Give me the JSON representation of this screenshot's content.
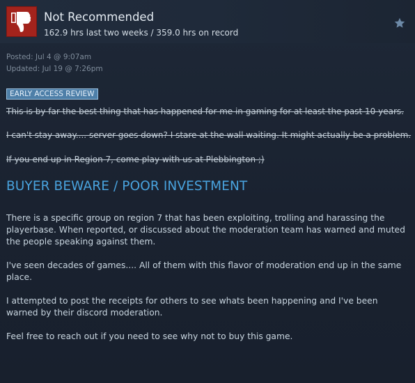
{
  "review": {
    "recommendation": "Not Recommended",
    "hours": "162.9 hrs last two weeks / 359.0 hrs on record",
    "posted": "Posted: Jul 4 @ 9:07am",
    "updated": "Updated: Jul 19 @ 7:26pm",
    "badge": "EARLY ACCESS REVIEW",
    "struck_lines": [
      "This is by far the best thing that has happened for me in gaming for at least the past 10 years.",
      "I can't stay away.... server goes down? I stare at the wall waiting. It might actually be a problem.",
      "If you end up in Region 7, come play with us at Plebbington ;)"
    ],
    "headline": "BUYER BEWARE / POOR INVESTMENT",
    "paragraphs": [
      "There is a specific group on region 7 that has been exploiting, trolling and harassing the playerbase. When reported, or discussed about the moderation team has warned and muted the people speaking against them.",
      "I've seen decades of games.... All of them with this flavor of moderation end up in the same place.",
      "I attempted to post the receipts for others to see whats been happening and I've been warned by their discord moderation.",
      "Feel free to reach out if you need to see why not to buy this game."
    ]
  },
  "icons": {
    "thumb": "thumbs-down-icon",
    "star": "star-icon"
  },
  "colors": {
    "background": "#1b2333",
    "thumb_box": "#a3231c",
    "headline": "#49a3de",
    "badge": "#4e7fa8"
  }
}
